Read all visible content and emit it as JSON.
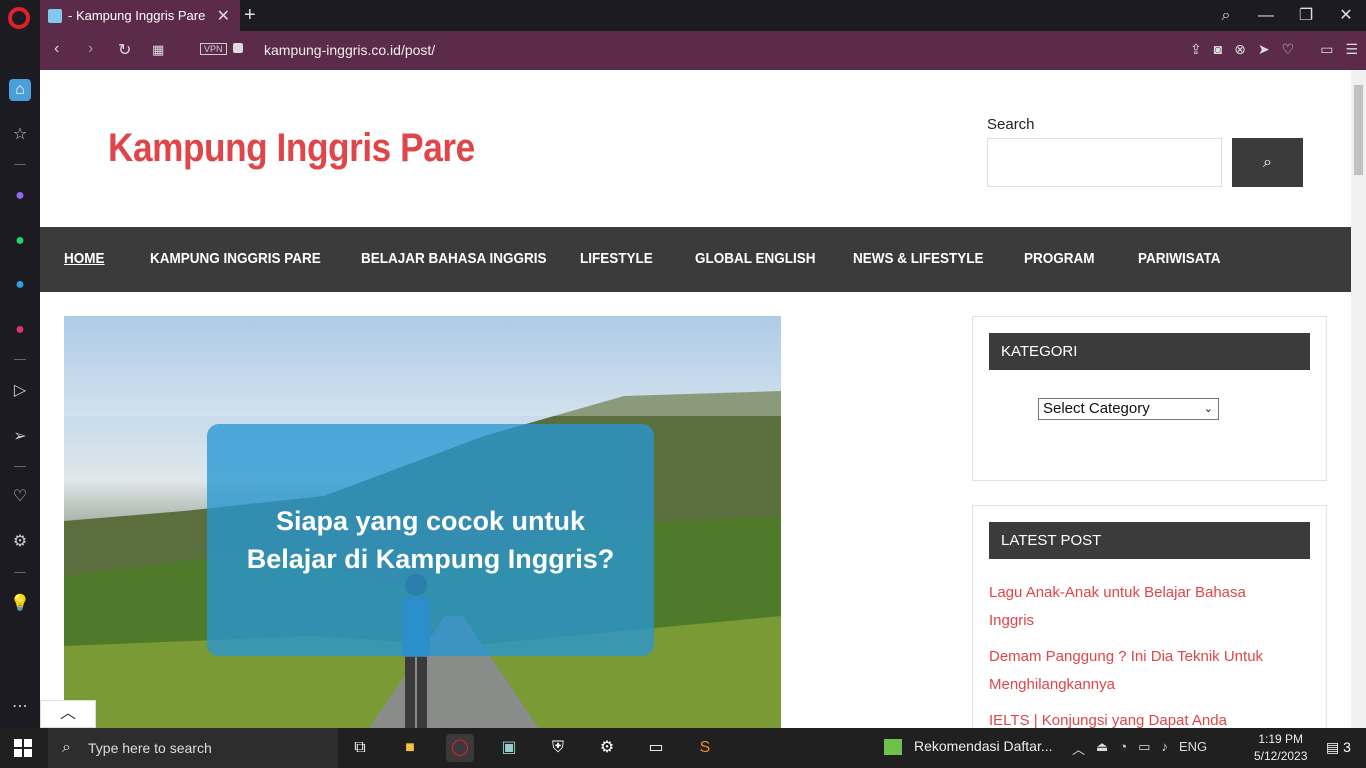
{
  "browser": {
    "tab_title": "- Kampung Inggris Pare",
    "url": "kampung-inggris.co.id/post/",
    "vpn_label": "VPN"
  },
  "site": {
    "title": "Kampung Inggris Pare",
    "search_label": "Search",
    "nav": [
      "HOME",
      "KAMPUNG INGGRIS PARE",
      "BELAJAR BAHASA INGGRIS",
      "LIFESTYLE",
      "GLOBAL ENGLISH",
      "NEWS & LIFESTYLE",
      "PROGRAM",
      "PARIWISATA"
    ],
    "hero": {
      "line1": "Siapa yang cocok untuk",
      "line2": "Belajar di Kampung Inggris?"
    },
    "kategori": {
      "heading": "KATEGORI",
      "select_value": "Select Category"
    },
    "latest": {
      "heading": "LATEST POST",
      "posts": [
        "Lagu Anak-Anak untuk Belajar Bahasa Inggris",
        "Demam Panggung ? Ini Dia Teknik Untuk Menghilangkannya",
        "IELTS | Konjungsi yang Dapat Anda"
      ]
    }
  },
  "taskbar": {
    "search_placeholder": "Type here to search",
    "notification": "Rekomendasi Daftar...",
    "language": "ENG",
    "time": "1:19 PM",
    "date": "5/12/2023",
    "notif_count": "3"
  },
  "colors": {
    "accent": "#e0454a",
    "nav_bg": "#3b3b3b",
    "browser_bar": "#5d2b4a"
  }
}
